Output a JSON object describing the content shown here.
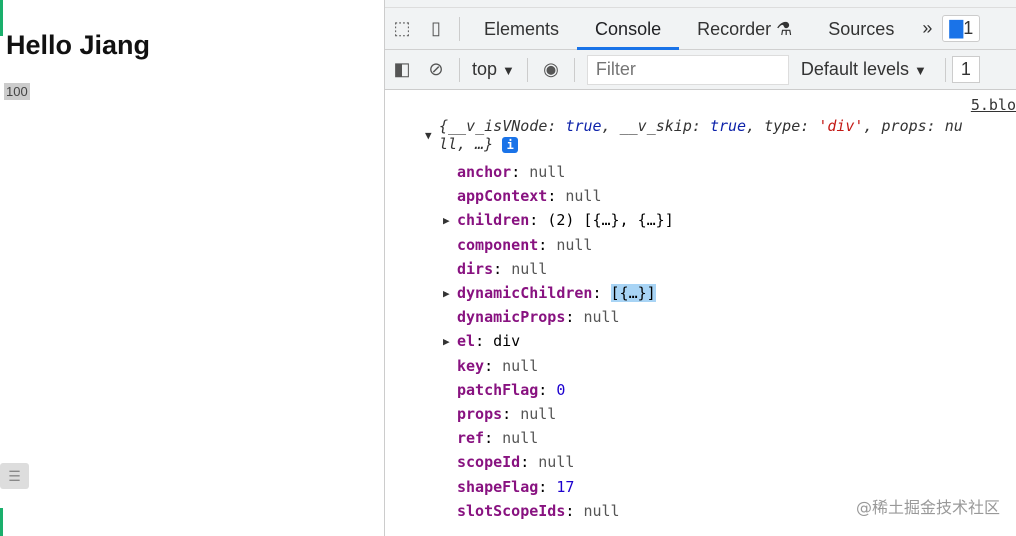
{
  "page": {
    "heading": "Hello Jiang",
    "count": "100",
    "list_icon": "☰"
  },
  "devtools": {
    "tabs": [
      "Elements",
      "Console",
      "Recorder",
      "Sources"
    ],
    "more": "»",
    "issues_count": "1",
    "context": "top",
    "filter_placeholder": "Filter",
    "levels": "Default levels",
    "issues_short": "1",
    "source_link": "5.blo",
    "summary": {
      "p1": "{__v_isVNode: ",
      "v1": "true",
      ",": ", ",
      "p2": "__v_skip: ",
      "v2": "true",
      "p3": ", type: ",
      "v3": "'div'",
      "p4": ", props: nu",
      "p5": "ll, …}",
      "info": "i"
    },
    "props": [
      {
        "key": "anchor",
        "value": "null",
        "type": "n"
      },
      {
        "key": "appContext",
        "value": "null",
        "type": "n"
      },
      {
        "key": "children",
        "value": "(2) [{…}, {…}]",
        "type": "o",
        "expand": true
      },
      {
        "key": "component",
        "value": "null",
        "type": "n"
      },
      {
        "key": "dirs",
        "value": "null",
        "type": "n"
      },
      {
        "key": "dynamicChildren",
        "value": "[{…}]",
        "type": "o",
        "expand": true,
        "highlight": true
      },
      {
        "key": "dynamicProps",
        "value": "null",
        "type": "n"
      },
      {
        "key": "el",
        "value": "div",
        "type": "o",
        "expand": true
      },
      {
        "key": "key",
        "value": "null",
        "type": "n"
      },
      {
        "key": "patchFlag",
        "value": "0",
        "type": "num"
      },
      {
        "key": "props",
        "value": "null",
        "type": "n"
      },
      {
        "key": "ref",
        "value": "null",
        "type": "n"
      },
      {
        "key": "scopeId",
        "value": "null",
        "type": "n"
      },
      {
        "key": "shapeFlag",
        "value": "17",
        "type": "num"
      },
      {
        "key": "slotScopeIds",
        "value": "null",
        "type": "n"
      }
    ]
  },
  "watermark": "@稀土掘金技术社区"
}
